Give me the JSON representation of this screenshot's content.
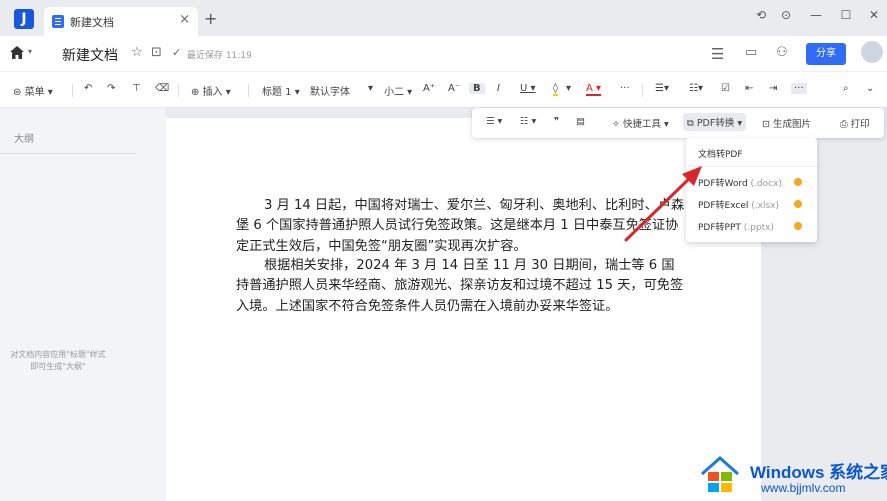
{
  "tab": {
    "title": "新建文档",
    "close": "×",
    "add": "+"
  },
  "window": {
    "btn1": "⟲",
    "btn2": "⊙",
    "minimize": "—",
    "maximize": "☐",
    "close": "✕"
  },
  "header": {
    "doc_title": "新建文档",
    "save_status": "最近保存 11:19",
    "share_label": "分享"
  },
  "toolbar": {
    "menu": "菜单 ▾",
    "insert": "插入 ▾",
    "heading": "标题 1 ▾",
    "font": "默认字体",
    "size": "小二 ▾",
    "grow": "A⁺",
    "shrink": "A⁻",
    "bold": "B",
    "italic": "I",
    "underline": "U ▾",
    "color": "A ▾",
    "more": "···"
  },
  "float_bar": {
    "quick_tools": "快捷工具 ▾",
    "pdf_convert": "PDF转换 ▾",
    "gen_image": "生成图片",
    "print": "打印"
  },
  "dropdown": {
    "items": [
      {
        "label": "文档转PDF",
        "ext": ""
      },
      {
        "label": "PDF转Word",
        "ext": "(.docx)"
      },
      {
        "label": "PDF转Excel",
        "ext": "(.xlsx)"
      },
      {
        "label": "PDF转PPT",
        "ext": "(.pptx)"
      }
    ]
  },
  "sidebar": {
    "outline_title": "大纲",
    "hint_line1": "对文档内容应用\"标题\"样式",
    "hint_line2": "即可生成\"大纲\""
  },
  "document": {
    "paragraphs": [
      "3 月 14 日起，中国将对瑞士、爱尔兰、匈牙利、奥地利、比利时、卢森堡 6 个国家持普通护照人员试行免签政策。这是继本月 1 日中泰互免签证协定正式生效后，中国免签“朋友圈”实现再次扩容。",
      "根据相关安排，2024 年 3 月 14 日至 11 月 30 日期间，瑞士等 6 国持普通护照人员来华经商、旅游观光、探亲访友和过境不超过 15 天，可免签入境。上述国家不符合免签条件人员仍需在入境前办妥来华签证。"
    ]
  },
  "watermark": {
    "title": "Windows 系统之家",
    "url": "www.bjjmlv.com"
  },
  "colors": {
    "accent": "#2f6df6",
    "arrow": "#d9262c",
    "watermark": "#0a57c9"
  }
}
